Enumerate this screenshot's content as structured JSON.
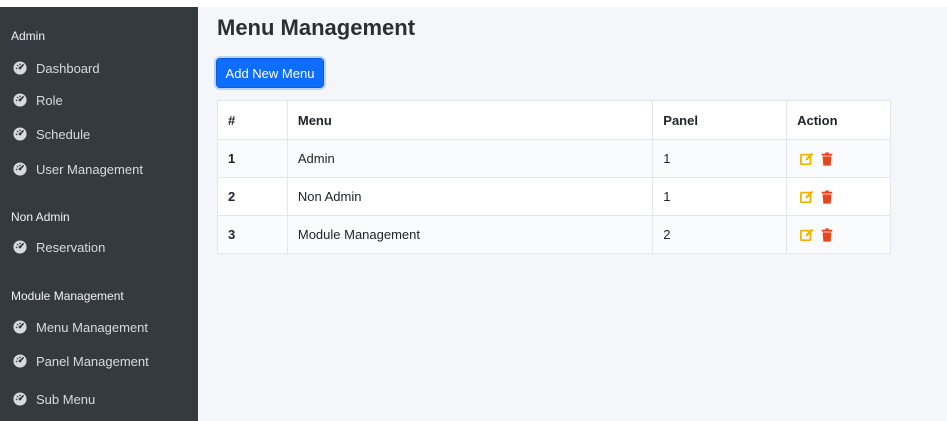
{
  "sidebar": {
    "sections": [
      {
        "title": "Admin",
        "items": [
          {
            "label": "Dashboard"
          },
          {
            "label": "Role"
          },
          {
            "label": "Schedule"
          },
          {
            "label": "User Management"
          }
        ]
      },
      {
        "title": "Non Admin",
        "items": [
          {
            "label": "Reservation"
          }
        ]
      },
      {
        "title": "Module Management",
        "items": [
          {
            "label": "Menu Management"
          },
          {
            "label": "Panel Management"
          },
          {
            "label": "Sub Menu"
          }
        ]
      }
    ],
    "item_icon": "tachometer-icon"
  },
  "main": {
    "title": "Menu Management",
    "add_button_label": "Add New Menu",
    "table": {
      "headers": [
        "#",
        "Menu",
        "Panel",
        "Action"
      ],
      "rows": [
        {
          "num": "1",
          "menu": "Admin",
          "panel": "1"
        },
        {
          "num": "2",
          "menu": "Non Admin",
          "panel": "1"
        },
        {
          "num": "3",
          "menu": "Module Management",
          "panel": "2"
        }
      ],
      "action_icons": [
        "edit-icon",
        "trash-icon"
      ]
    }
  },
  "colors": {
    "sidebar_bg": "#343a40",
    "primary": "#0d6efd",
    "edit": "#f0b400",
    "delete": "#e8441d"
  }
}
